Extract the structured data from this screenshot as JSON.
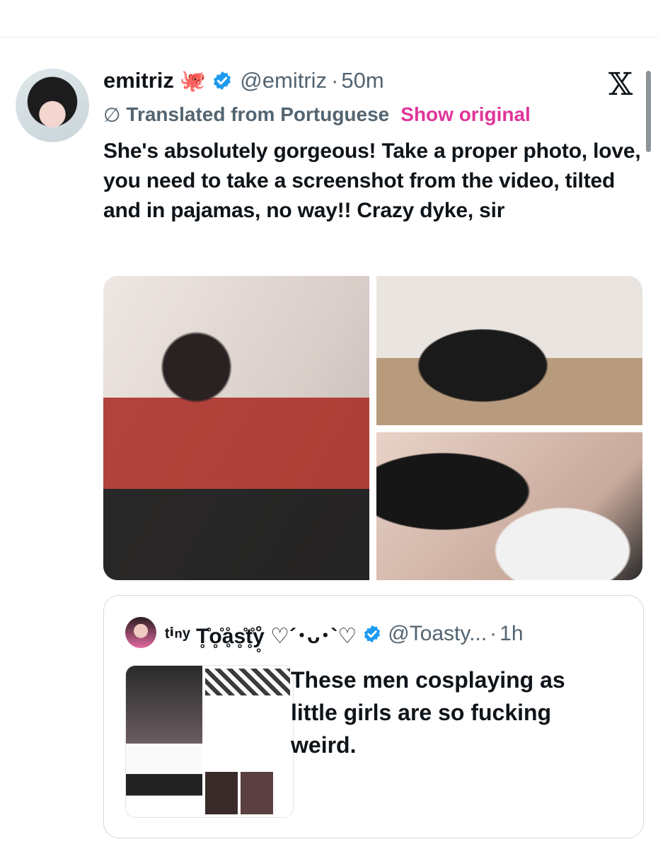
{
  "tweet": {
    "display_name": "emitriz",
    "name_emoji": "🐙",
    "handle": "@emitriz",
    "separator": "·",
    "time": "50m",
    "translation_label": "Translated from Portuguese",
    "show_original_label": "Show original",
    "text": "She's absolutely gorgeous! Take a proper photo, love, you need to take a screenshot from the video, tilted and in pajamas, no way!! Crazy dyke, sir",
    "media_count": 3
  },
  "app_logo_icon": "x-logo-icon",
  "quoted_tweet": {
    "display_name": "ᵗⁱⁿʸ T̥̊o̥̊ḁ̊s̥̊t̥̊ẙ̥ ♡´･ᴗ･`♡",
    "handle": "@Toasty...",
    "separator": "·",
    "time": "1h",
    "text": "These men cosplaying as little girls are so fucking weird."
  },
  "colors": {
    "verified_blue": "#1d9bf0",
    "show_original_pink": "#e0359a",
    "secondary_text": "#536471"
  }
}
